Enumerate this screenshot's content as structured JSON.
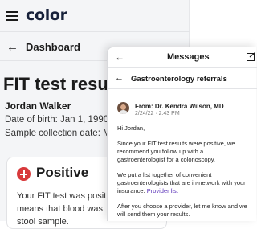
{
  "app": {
    "logo": "color"
  },
  "nav": {
    "back_label": "Dashboard"
  },
  "page": {
    "title": "FIT test results",
    "patient_name": "Jordan Walker",
    "dob": "Date of birth: Jan 1, 1990",
    "collection": "Sample collection date: M"
  },
  "result": {
    "label": "Positive",
    "line1": "Your FIT test was posit",
    "line2": "means that blood was",
    "line3": "stool sample."
  },
  "messages": {
    "title": "Messages",
    "thread": "Gastroenterology referrals",
    "from": "From: Dr. Kendra Wilson, MD",
    "date": "2/24/22 · 2:43 PM",
    "greeting": "Hi Jordan,",
    "para1": "Since your FIT test results were positive, we recommend you follow up with a gastroenterologist for a colonoscopy.",
    "para2_prefix": "We put a list together of convenient gastroenterologists that are in-network with your insurance: ",
    "para2_link": "Provider list",
    "para3": "After you choose a provider, let me know and we will send them your results."
  },
  "colors": {
    "positive": "#d8393b",
    "link": "#5a32b8",
    "brand": "#17213a"
  }
}
